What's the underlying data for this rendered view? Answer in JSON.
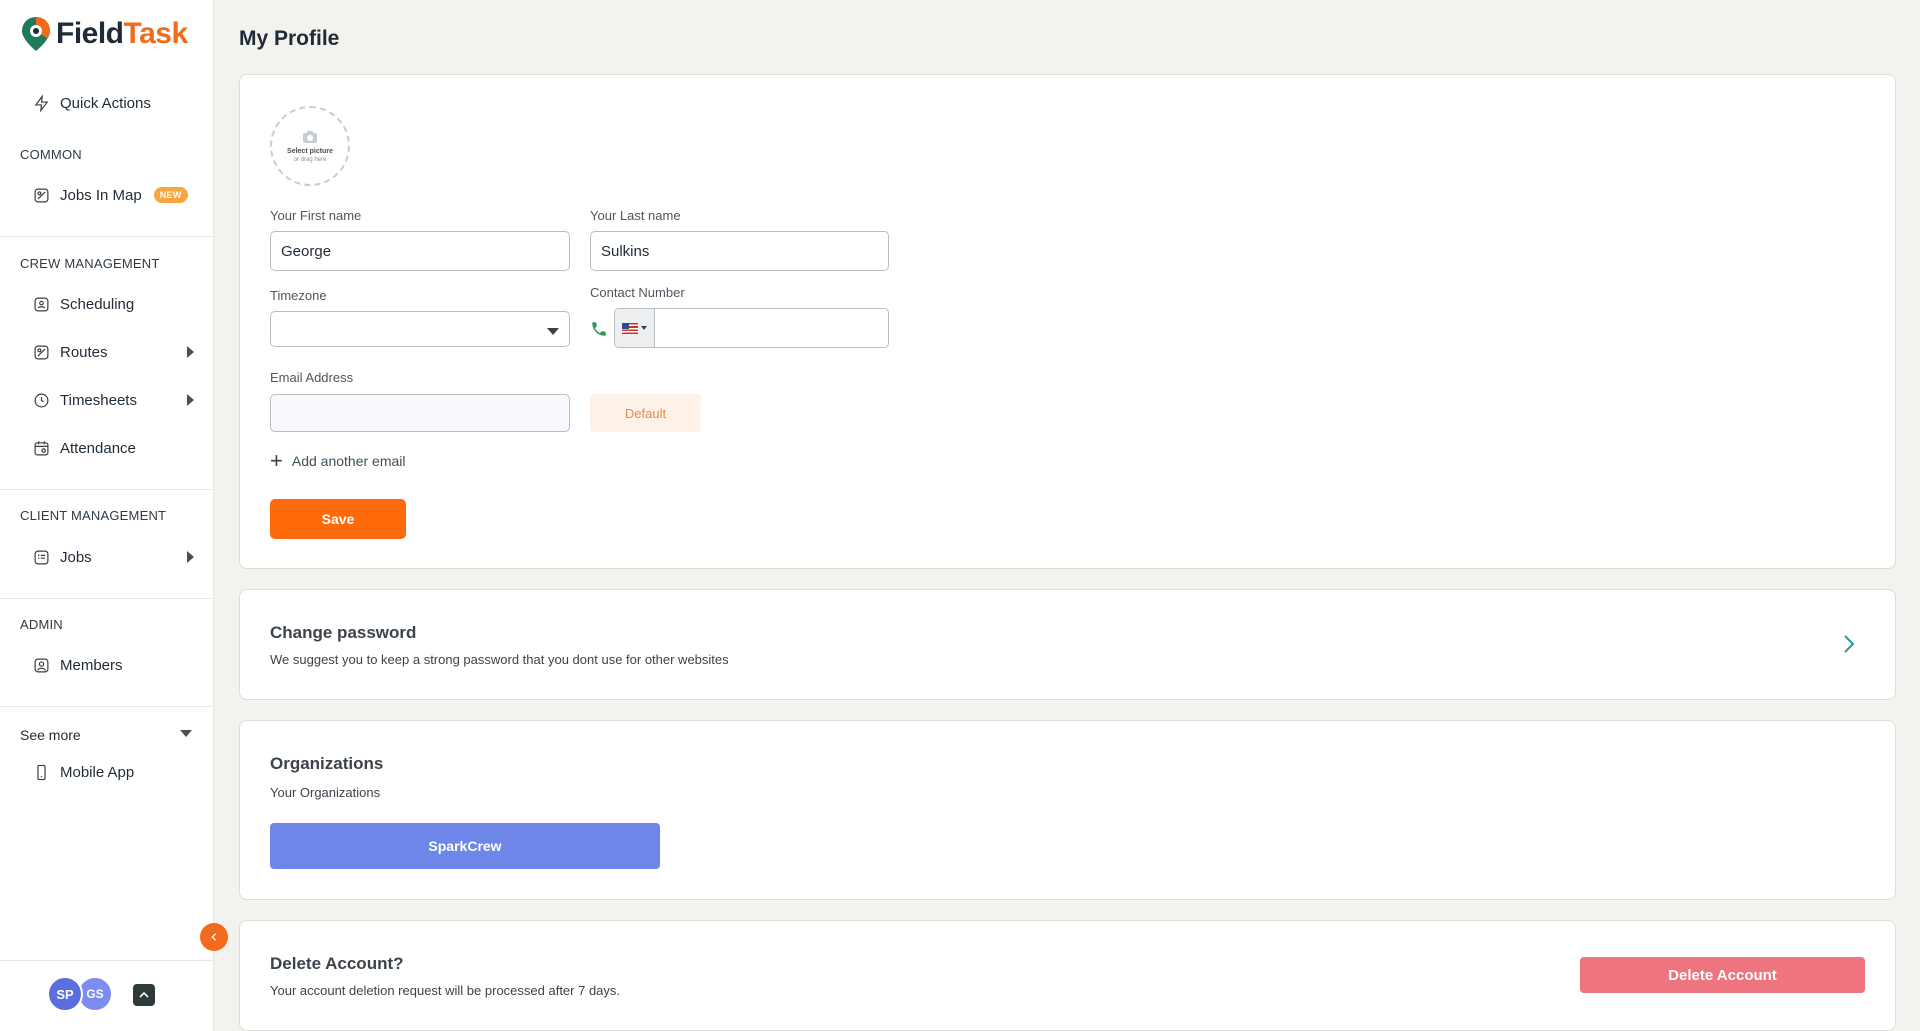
{
  "brand": {
    "name_part1": "Field",
    "name_part2": "Task",
    "accent": "#f26a1b"
  },
  "sidebar": {
    "quick_actions": "Quick Actions",
    "sections": {
      "common": "COMMON",
      "crew": "CREW MANAGEMENT",
      "client": "CLIENT MANAGEMENT",
      "admin": "ADMIN"
    },
    "items": {
      "jobs_in_map": "Jobs In Map",
      "new_badge": "NEW",
      "scheduling": "Scheduling",
      "routes": "Routes",
      "timesheets": "Timesheets",
      "attendance": "Attendance",
      "jobs": "Jobs",
      "members": "Members",
      "mobile_app": "Mobile App"
    },
    "see_more": "See more",
    "collapse_icon": "chevron-left-icon",
    "avatars": [
      "SP",
      "GS"
    ]
  },
  "page": {
    "title": "My Profile"
  },
  "profile": {
    "picture_line1": "Select picture",
    "picture_line2": "or drag here",
    "first_name_label": "Your First name",
    "first_name_value": "George",
    "last_name_label": "Your Last name",
    "last_name_value": "Sulkins",
    "timezone_label": "Timezone",
    "timezone_value": "",
    "contact_label": "Contact Number",
    "contact_value": "",
    "email_label": "Email Address",
    "email_value": "",
    "default_label": "Default",
    "add_email_label": "Add another email",
    "save_label": "Save"
  },
  "password": {
    "title": "Change password",
    "subtitle": "We suggest you to keep a strong password that you dont use for other websites"
  },
  "organizations": {
    "title": "Organizations",
    "subtitle": "Your Organizations",
    "items": [
      "SparkCrew"
    ]
  },
  "delete_account": {
    "title": "Delete Account?",
    "subtitle": "Your account deletion request will be processed after 7 days.",
    "button": "Delete Account"
  },
  "colors": {
    "save": "#fe6a0a",
    "org_button": "#6e86e8",
    "delete_button": "#ee7580",
    "badge": "#f7a541"
  }
}
